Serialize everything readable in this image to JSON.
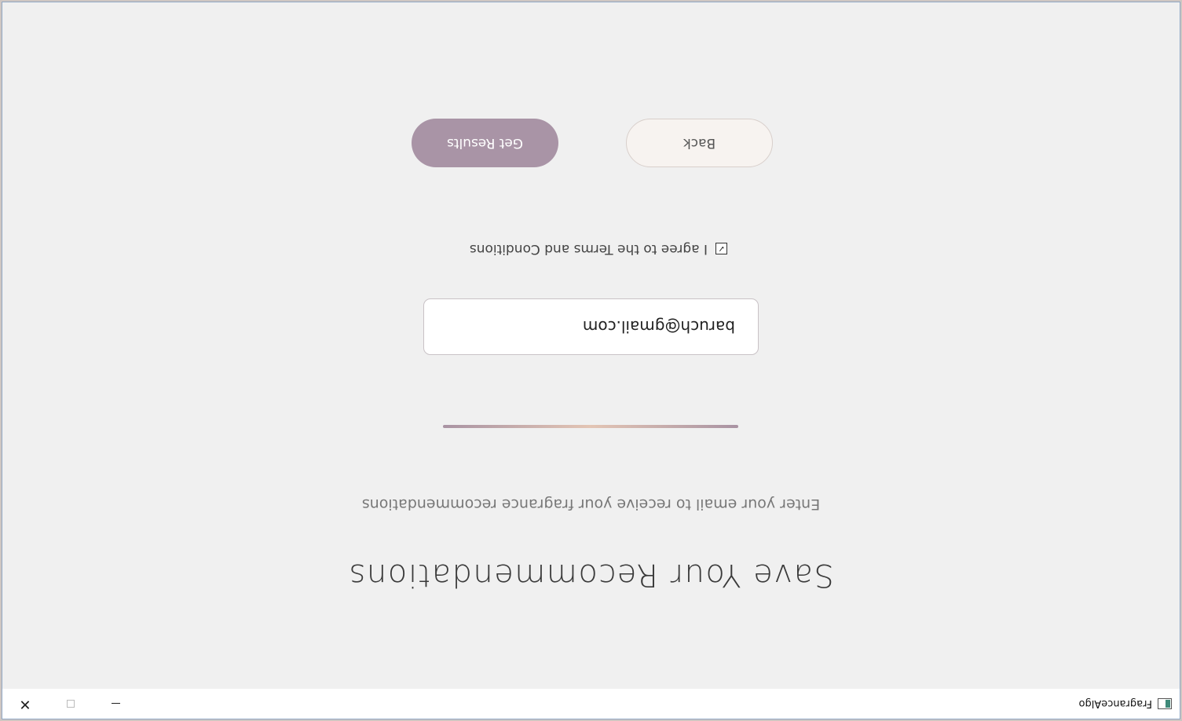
{
  "window": {
    "title": "FragranceAlgo",
    "controls": {
      "minimize": "–",
      "maximize": "□",
      "close": "✕"
    }
  },
  "form": {
    "heading": "Save Your Recommendations",
    "subheading": "Enter your email to receive your fragrance recommendations",
    "email_value": "baruch@gmail.com",
    "terms_label": "I agree to the Terms and Conditions",
    "terms_checked": true,
    "back_label": "Back",
    "submit_label": "Get Results"
  },
  "colors": {
    "primary_button": "#a994a6",
    "secondary_button": "#f7f3f0",
    "background": "#f0f0f0"
  }
}
